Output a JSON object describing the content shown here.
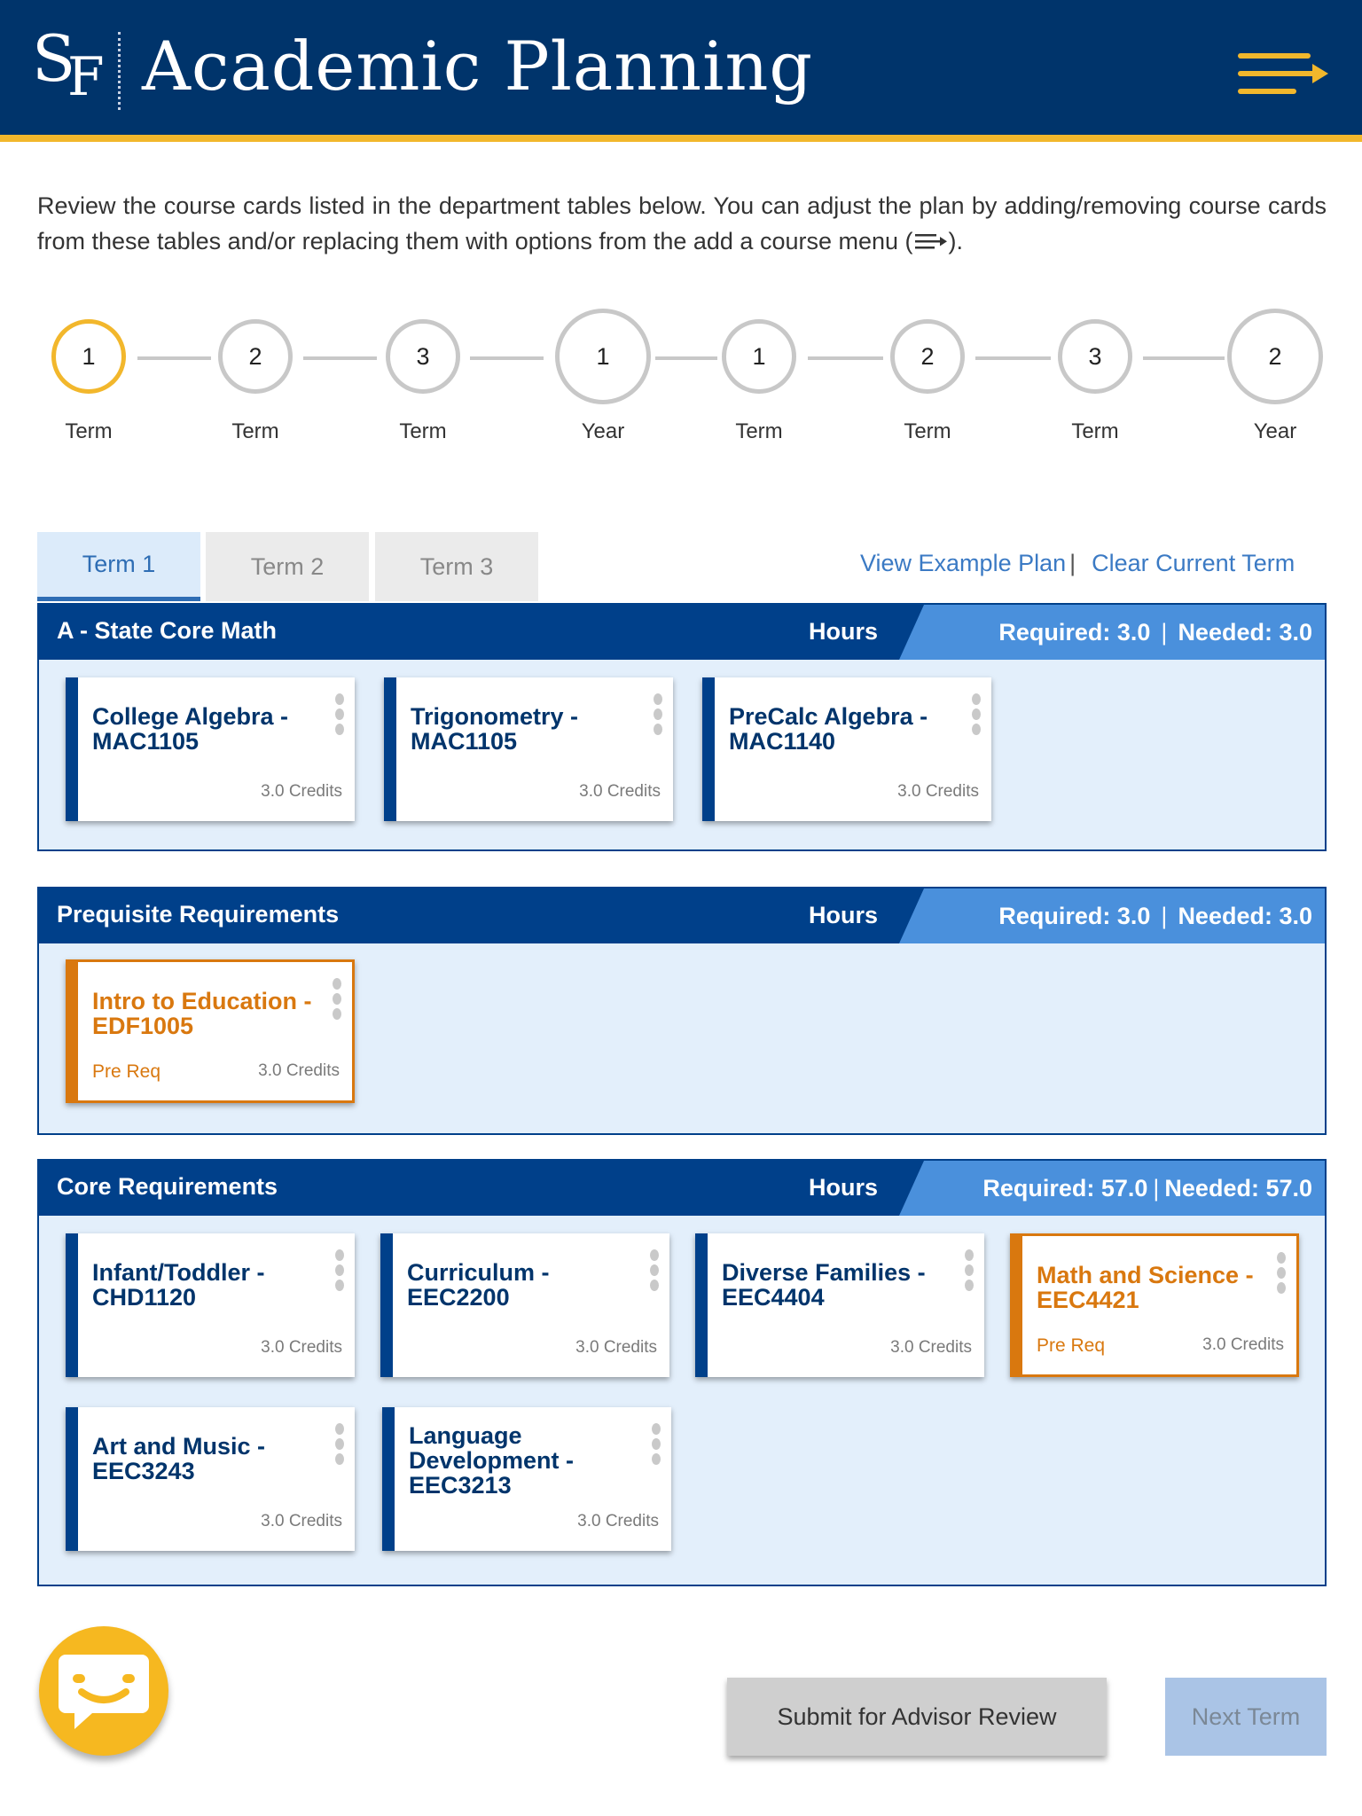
{
  "header": {
    "logo_s": "S",
    "logo_f": "F",
    "title": "Academic Planning"
  },
  "intro": {
    "text_before_icon": "Review the course cards listed in the department tables below. You can adjust the plan by adding/removing course cards from these tables and/or replacing them with options from the add a course menu (",
    "text_after_icon": ")."
  },
  "stepper": [
    {
      "number": "1",
      "label": "Term",
      "active": true
    },
    {
      "number": "2",
      "label": "Term",
      "active": false
    },
    {
      "number": "3",
      "label": "Term",
      "active": false
    },
    {
      "number": "1",
      "label": "Year",
      "active": false
    },
    {
      "number": "1",
      "label": "Term",
      "active": false
    },
    {
      "number": "2",
      "label": "Term",
      "active": false
    },
    {
      "number": "3",
      "label": "Term",
      "active": false
    },
    {
      "number": "2",
      "label": "Year",
      "active": false
    }
  ],
  "tabs": [
    {
      "label": "Term 1",
      "active": true
    },
    {
      "label": "Term 2",
      "active": false
    },
    {
      "label": "Term 3",
      "active": false
    }
  ],
  "links": {
    "view_example": "View Example Plan",
    "separator": "|",
    "clear_term": "Clear Current Term"
  },
  "sections": [
    {
      "title": "A - State Core Math",
      "hours_label": "Hours",
      "required": "Required: 3.0",
      "needed": "Needed: 3.0",
      "cards": [
        {
          "title": "College Algebra - MAC1105",
          "credits": "3.0 Credits",
          "tag": "",
          "prereq": false
        },
        {
          "title": "Trigonometry - MAC1105",
          "credits": "3.0 Credits",
          "tag": "",
          "prereq": false
        },
        {
          "title": "PreCalc Algebra - MAC1140",
          "credits": "3.0 Credits",
          "tag": "",
          "prereq": false
        }
      ]
    },
    {
      "title": "Prequisite Requirements",
      "hours_label": "Hours",
      "required": "Required: 3.0",
      "needed": "Needed: 3.0",
      "cards": [
        {
          "title": "Intro to Education - EDF1005",
          "credits": "3.0 Credits",
          "tag": "Pre Req",
          "prereq": true
        }
      ]
    },
    {
      "title": "Core Requirements",
      "hours_label": "Hours",
      "required": "Required: 57.0",
      "needed": "Needed: 57.0",
      "cards": [
        {
          "title": "Infant/Toddler - CHD1120",
          "credits": "3.0 Credits",
          "tag": "",
          "prereq": false
        },
        {
          "title": "Curriculum - EEC2200",
          "credits": "3.0 Credits",
          "tag": "",
          "prereq": false
        },
        {
          "title": "Diverse Families - EEC4404",
          "credits": "3.0 Credits",
          "tag": "",
          "prereq": false
        },
        {
          "title": "Math and Science - EEC4421",
          "credits": "3.0 Credits",
          "tag": "Pre Req",
          "prereq": true
        },
        {
          "title": "Art and Music - EEC3243",
          "credits": "3.0 Credits",
          "tag": "",
          "prereq": false
        },
        {
          "title": "Language Development - EEC3213",
          "credits": "3.0 Credits",
          "tag": "",
          "prereq": false
        }
      ]
    }
  ],
  "footer": {
    "submit_label": "Submit for Advisor Review",
    "next_label": "Next Term"
  },
  "colors": {
    "brand_navy": "#00346b",
    "section_blue": "#00408a",
    "accent_gold": "#f2b72c",
    "prereq_orange": "#d9780f",
    "link_blue": "#3b7ac4"
  }
}
